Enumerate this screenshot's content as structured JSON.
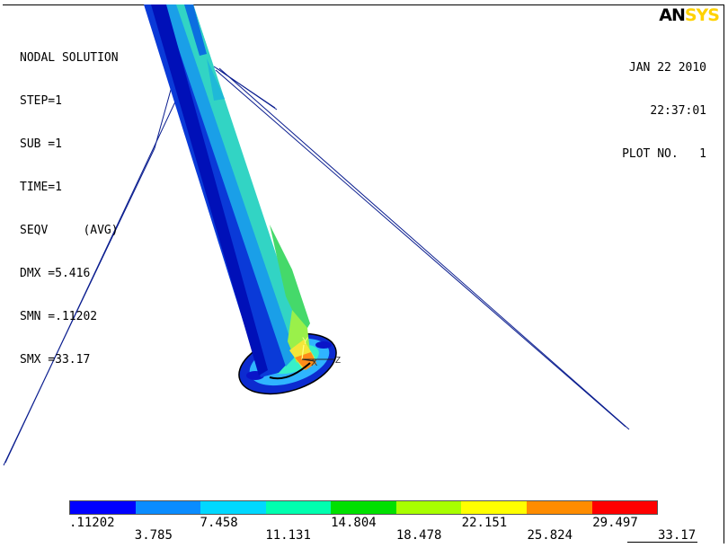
{
  "logo": {
    "part1": "AN",
    "part2": "SYS"
  },
  "info": {
    "title": "NODAL SOLUTION",
    "step": "STEP=1",
    "sub": "SUB =1",
    "time": "TIME=1",
    "seqv": "SEQV     (AVG)",
    "dmx": "DMX =5.416",
    "smn": "SMN =.11202",
    "smx": "SMX =33.17"
  },
  "stamp": {
    "date": "JAN 22 2010",
    "time": "22:37:01",
    "plot": "PLOT NO.   1"
  },
  "triad": {
    "y": "Y",
    "x": "X",
    "z": "Z"
  },
  "legend": {
    "colors": [
      "#0000ff",
      "#0a8cff",
      "#00d8ff",
      "#00ffaf",
      "#00e000",
      "#a8ff00",
      "#ffff00",
      "#ff8c00",
      "#ff0000"
    ],
    "labels_top": [
      ".11202",
      "7.458",
      "14.804",
      "22.151",
      "29.497"
    ],
    "labels_bottom": [
      "3.785",
      "11.131",
      "18.478",
      "25.824",
      "33.17"
    ]
  }
}
